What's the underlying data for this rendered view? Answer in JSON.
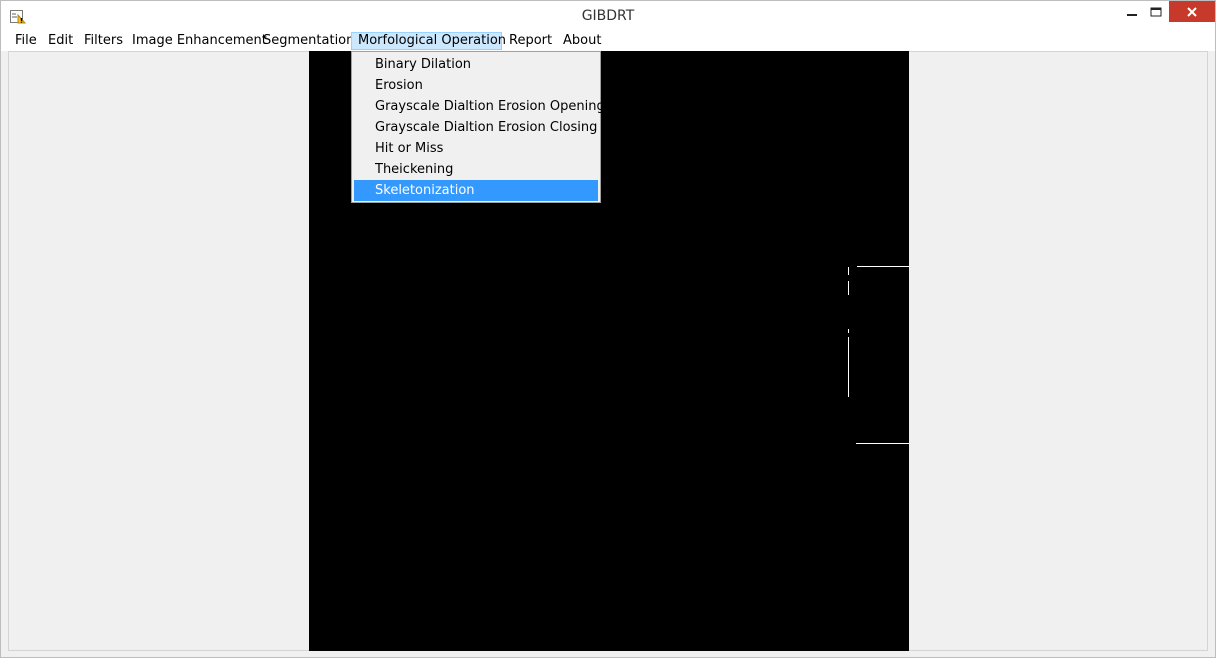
{
  "window": {
    "title": "GIBDRT",
    "icon": "java-app-icon",
    "controls": {
      "minimize": "minimize-icon",
      "maximize": "maximize-icon",
      "close": "close-icon"
    },
    "close_color": "#c7392b"
  },
  "menubar": {
    "items": [
      {
        "label": "File"
      },
      {
        "label": "Edit"
      },
      {
        "label": "Filters"
      },
      {
        "label": "Image Enhancement"
      },
      {
        "label": "Segmentation"
      },
      {
        "label": "Morfological Operation",
        "active": true
      },
      {
        "label": "Report"
      },
      {
        "label": "About"
      }
    ]
  },
  "dropdown": {
    "items": [
      {
        "label": "Binary Dilation"
      },
      {
        "label": "Erosion"
      },
      {
        "label": "Grayscale Dialtion Erosion Opening"
      },
      {
        "label": "Grayscale Dialtion Erosion Closing"
      },
      {
        "label": "Hit or Miss"
      },
      {
        "label": "Theickening"
      },
      {
        "label": "Skeletonization",
        "selected": true
      }
    ],
    "highlight_color": "#3399ff"
  },
  "canvas": {
    "background": "#000000",
    "content": "binary-edge-image"
  }
}
